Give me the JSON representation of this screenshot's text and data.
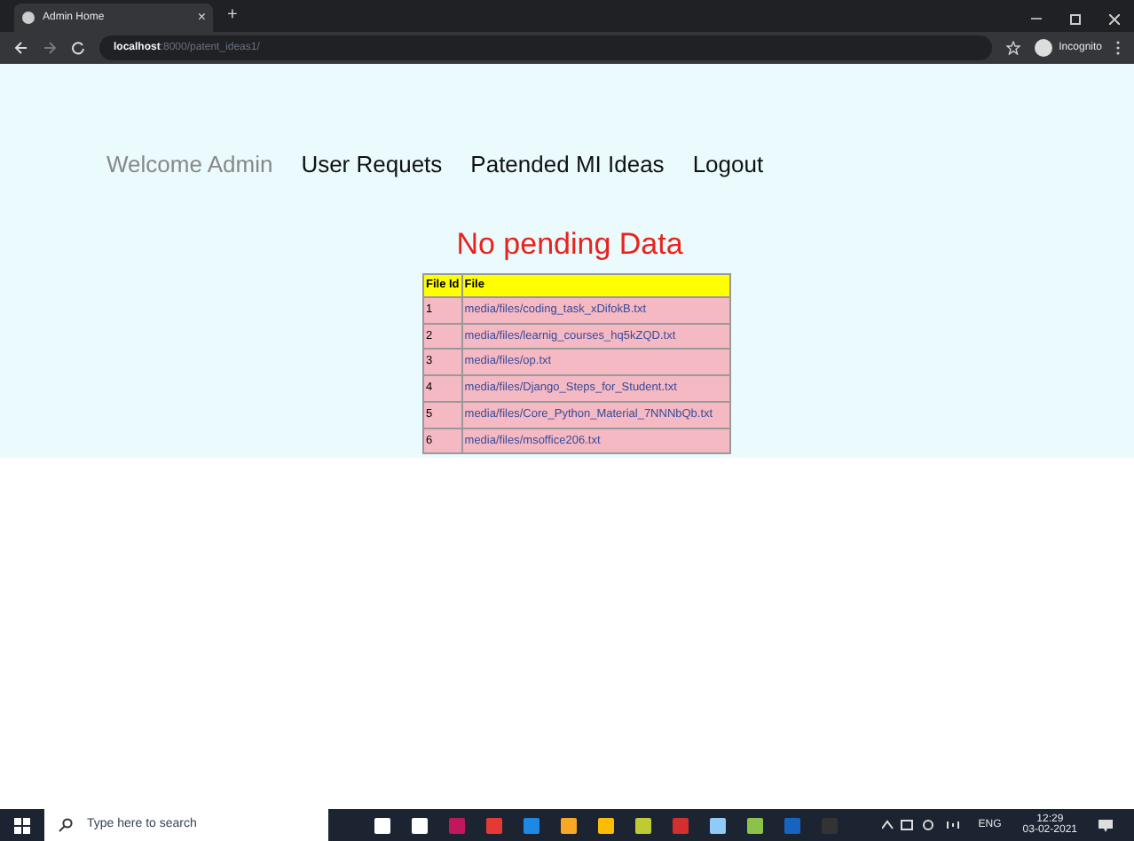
{
  "browser": {
    "tab_title": "Admin Home",
    "tab_close": "×",
    "new_tab": "+",
    "url_host": "localhost",
    "url_path": ":8000/patent_ideas1/",
    "profile": "Incognito"
  },
  "nav": {
    "welcome": "Welcome Admin",
    "links": [
      "User Requets",
      "Patended MI Ideas",
      "Logout"
    ]
  },
  "message": "No pending Data",
  "table": {
    "columns": [
      "File Id",
      "File"
    ],
    "rows": [
      [
        "1",
        "media/files/coding_task_xDifokB.txt"
      ],
      [
        "2",
        "media/files/learnig_courses_hq5kZQD.txt"
      ],
      [
        "3",
        "media/files/op.txt"
      ],
      [
        "4",
        "media/files/Django_Steps_for_Student.txt"
      ],
      [
        "5",
        "media/files/Core_Python_Material_7NNNbQb.txt"
      ],
      [
        "6",
        "media/files/msoffice206.txt"
      ]
    ]
  },
  "taskbar": {
    "search_placeholder": "Type here to search",
    "language": "ENG",
    "time": "12:29",
    "date": "03-02-2021"
  }
}
